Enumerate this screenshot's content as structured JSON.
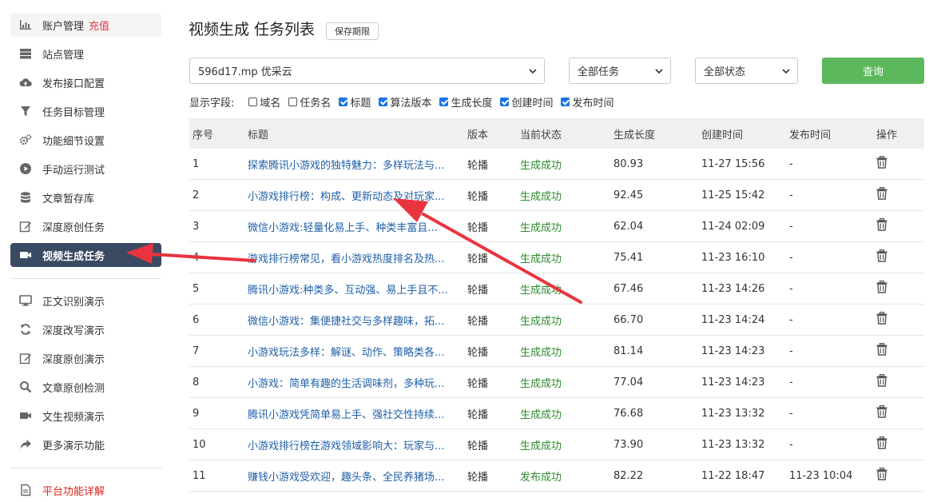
{
  "sidebar": {
    "items": [
      {
        "label": "账户管理",
        "extra": "充值",
        "icon": "bar-chart-icon"
      },
      {
        "label": "站点管理",
        "icon": "server-icon"
      },
      {
        "label": "发布接口配置",
        "icon": "cloud-upload-icon"
      },
      {
        "label": "任务目标管理",
        "icon": "filter-icon"
      },
      {
        "label": "功能细节设置",
        "icon": "gears-icon"
      },
      {
        "label": "手动运行测试",
        "icon": "play-circle-icon"
      },
      {
        "label": "文章暂存库",
        "icon": "database-icon"
      },
      {
        "label": "深度原创任务",
        "icon": "edit-icon"
      },
      {
        "label": "视频生成任务",
        "icon": "video-camera-icon"
      },
      {
        "label": "正文识别演示",
        "icon": "monitor-icon"
      },
      {
        "label": "深度改写演示",
        "icon": "refresh-icon"
      },
      {
        "label": "深度原创演示",
        "icon": "edit-icon"
      },
      {
        "label": "文章原创检测",
        "icon": "search-icon"
      },
      {
        "label": "文生视频演示",
        "icon": "video-camera-icon"
      },
      {
        "label": "更多演示功能",
        "icon": "share-icon"
      },
      {
        "label": "平台功能详解",
        "icon": "document-icon"
      }
    ]
  },
  "header": {
    "title": "视频生成 任务列表",
    "save_label": "保存期限"
  },
  "filters": {
    "site_value": "596d17.mp 优采云",
    "task_value": "全部任务",
    "status_value": "全部状态",
    "query_label": "查询"
  },
  "fields": {
    "label": "显示字段:",
    "options": [
      {
        "label": "域名",
        "checked": false
      },
      {
        "label": "任务名",
        "checked": false
      },
      {
        "label": "标题",
        "checked": true
      },
      {
        "label": "算法版本",
        "checked": true
      },
      {
        "label": "生成长度",
        "checked": true
      },
      {
        "label": "创建时间",
        "checked": true
      },
      {
        "label": "发布时间",
        "checked": true
      }
    ]
  },
  "table": {
    "headers": {
      "no": "序号",
      "title": "标题",
      "version": "版本",
      "status": "当前状态",
      "length": "生成长度",
      "created": "创建时间",
      "published": "发布时间",
      "op": "操作"
    },
    "rows": [
      {
        "no": "1",
        "title": "探索腾讯小游戏的独特魅力：多样玩法与...",
        "version": "轮播",
        "status": "生成成功",
        "length": "80.93",
        "created": "11-27 15:56",
        "published": "-"
      },
      {
        "no": "2",
        "title": "小游戏排行榜：构成、更新动态及对玩家...",
        "version": "轮播",
        "status": "生成成功",
        "length": "92.45",
        "created": "11-25 15:42",
        "published": "-"
      },
      {
        "no": "3",
        "title": "微信小游戏:轻量化易上手、种类丰富且...",
        "version": "轮播",
        "status": "生成成功",
        "length": "62.04",
        "created": "11-24 02:09",
        "published": "-"
      },
      {
        "no": "4",
        "title": "游戏排行榜常见，看小游戏热度排名及热...",
        "version": "轮播",
        "status": "生成成功",
        "length": "75.41",
        "created": "11-23 16:10",
        "published": "-"
      },
      {
        "no": "5",
        "title": "腾讯小游戏:种类多、互动强、易上手且不...",
        "version": "轮播",
        "status": "生成成功",
        "length": "67.46",
        "created": "11-23 14:26",
        "published": "-"
      },
      {
        "no": "6",
        "title": "微信小游戏：集便捷社交与多样趣味，拓...",
        "version": "轮播",
        "status": "生成成功",
        "length": "66.70",
        "created": "11-23 14:24",
        "published": "-"
      },
      {
        "no": "7",
        "title": "小游戏玩法多样：解谜、动作、策略类各...",
        "version": "轮播",
        "status": "生成成功",
        "length": "81.14",
        "created": "11-23 14:23",
        "published": "-"
      },
      {
        "no": "8",
        "title": "小游戏：简单有趣的生活调味剂，多种玩...",
        "version": "轮播",
        "status": "生成成功",
        "length": "77.04",
        "created": "11-23 14:23",
        "published": "-"
      },
      {
        "no": "9",
        "title": "腾讯小游戏凭简单易上手、强社交性持续...",
        "version": "轮播",
        "status": "生成成功",
        "length": "76.68",
        "created": "11-23 13:32",
        "published": "-"
      },
      {
        "no": "10",
        "title": "小游戏排行榜在游戏领域影响大：玩家与...",
        "version": "轮播",
        "status": "生成成功",
        "length": "73.90",
        "created": "11-23 13:32",
        "published": "-"
      },
      {
        "no": "11",
        "title": "赚钱小游戏受欢迎，趣头条、全民养猪场...",
        "version": "轮播",
        "status": "发布成功",
        "length": "82.22",
        "created": "11-22 18:47",
        "published": "11-23 10:04"
      }
    ]
  },
  "colors": {
    "accent_green": "#5cb85c",
    "active_nav": "#3b4a63",
    "link_blue": "#1f5fa8",
    "status_green": "#2e8b2e",
    "annotation_red": "#e8343f"
  }
}
